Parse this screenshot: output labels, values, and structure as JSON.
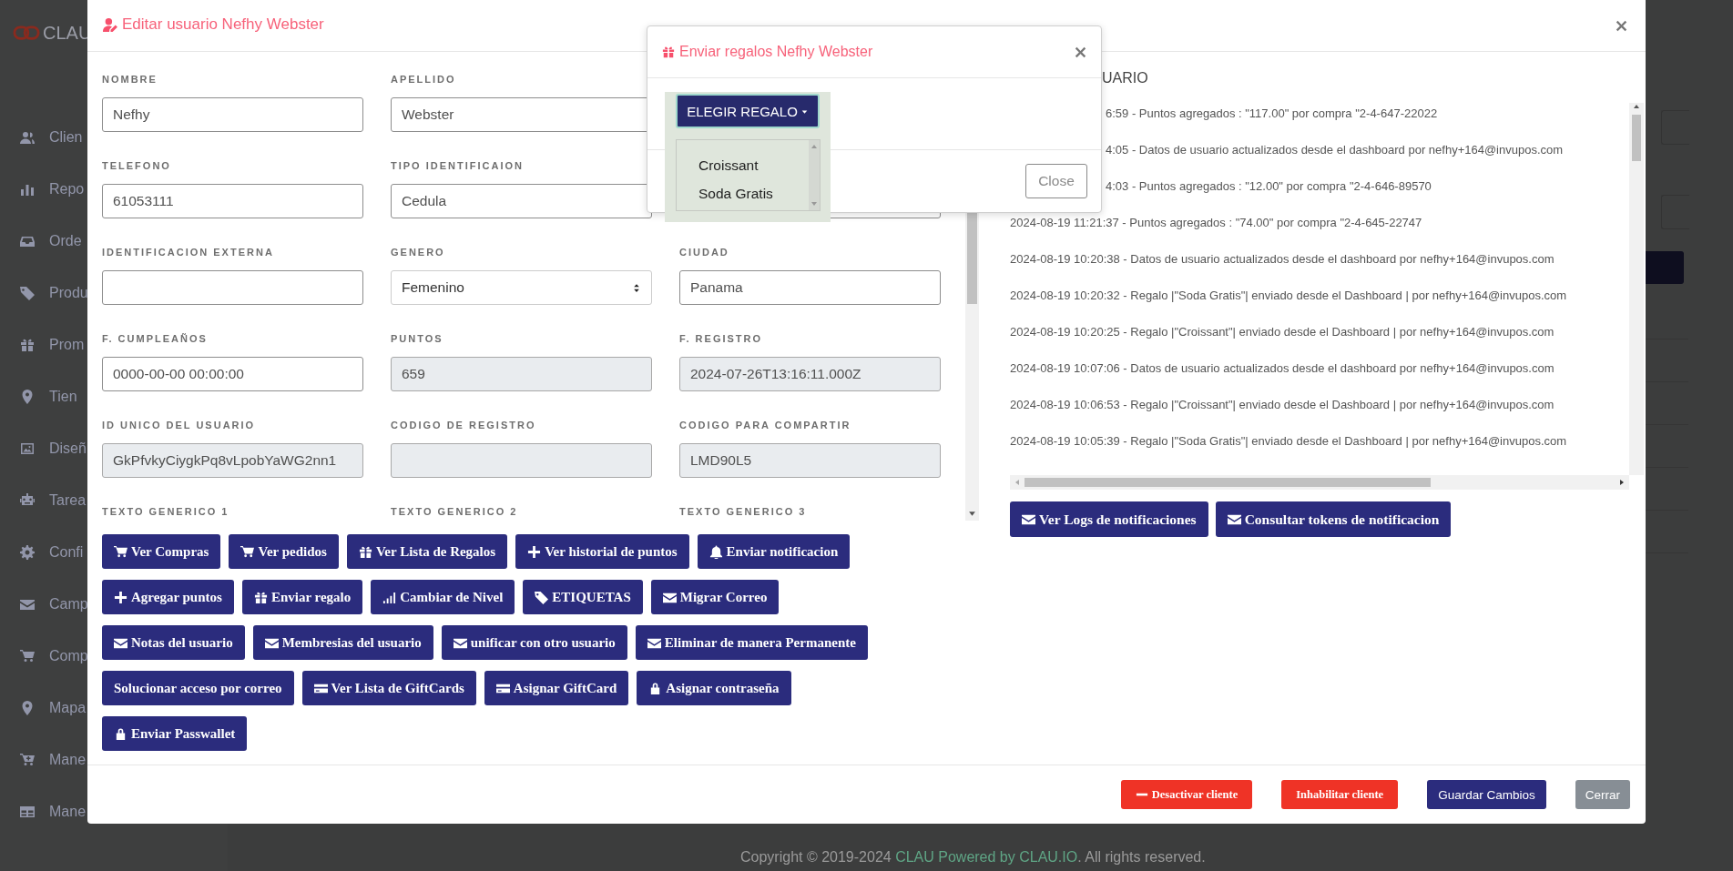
{
  "sidebar": {
    "logo": "CLAU",
    "items": [
      {
        "label": "Clien",
        "kind": "users"
      },
      {
        "label": "Repo",
        "kind": "bars"
      },
      {
        "label": "Orde",
        "kind": "inbox"
      },
      {
        "label": "Produ",
        "kind": "tag"
      },
      {
        "label": "Prom",
        "kind": "gift"
      },
      {
        "label": "Tien",
        "kind": "pin"
      },
      {
        "label": "Diseñ",
        "kind": "image"
      },
      {
        "label": "Tarea",
        "kind": "robot"
      },
      {
        "label": "Confi",
        "kind": "gear"
      },
      {
        "label": "Camp",
        "kind": "envelope"
      },
      {
        "label": "Comp",
        "kind": "cart"
      },
      {
        "label": "Mapa",
        "kind": "pin"
      },
      {
        "label": "Mane",
        "kind": "cartplus"
      },
      {
        "label": "Mane",
        "kind": "table"
      }
    ]
  },
  "footer": {
    "before": "Copyright © 2019-2024",
    "link": "CLAU Powered by CLAU.IO",
    "after": ". All rights reserved."
  },
  "modal": {
    "title": "Editar usuario Nefhy Webster",
    "fields": [
      [
        {
          "label": "NOMBRE",
          "value": "Nefhy",
          "kind": "input"
        },
        {
          "label": "APELLIDO",
          "value": "Webster",
          "kind": "input"
        }
      ],
      [
        {
          "label": "TELEFONO",
          "value": "61053111",
          "kind": "input"
        },
        {
          "label": "TIPO IDENTIFICAION",
          "value": "Cedula",
          "kind": "input"
        },
        {
          "kind": "input"
        }
      ],
      [
        {
          "label": "IDENTIFICACION EXTERNA",
          "kind": "input"
        },
        {
          "label": "GENERO",
          "value": "Femenino",
          "kind": "select"
        },
        {
          "label": "CIUDAD",
          "value": "Panama",
          "kind": "input"
        }
      ],
      [
        {
          "label": "F. CUMPLEAÑOS",
          "value": "0000-00-00 00:00:00",
          "kind": "input"
        },
        {
          "label": "PUNTOS",
          "value": "659",
          "kind": "disabled"
        },
        {
          "label": "F. REGISTRO",
          "value": "2024-07-26T13:16:11.000Z",
          "kind": "disabled"
        }
      ],
      [
        {
          "label": "ID UNICO DEL USUARIO",
          "value": "GkPfvkyCiygkPq8vLpobYaWG2nn1",
          "kind": "disabled"
        },
        {
          "label": "CODIGO DE REGISTRO",
          "kind": "disabled"
        },
        {
          "label": "CODIGO PARA COMPARTIR",
          "value": "LMD90L5",
          "kind": "disabled"
        }
      ],
      [
        {
          "label": "TEXTO GENERICO 1",
          "kind": "label"
        },
        {
          "label": "TEXTO GENERICO 2",
          "kind": "label"
        },
        {
          "label": "TEXTO GENERICO 3",
          "kind": "label"
        }
      ]
    ],
    "actions": [
      [
        {
          "label": "Ver Compras",
          "kind": "cart"
        },
        {
          "label": "Ver pedidos",
          "kind": "cart"
        },
        {
          "label": "Ver Lista de Regalos",
          "kind": "gift"
        },
        {
          "label": "Ver historial de puntos",
          "kind": "plus"
        },
        {
          "label": "Enviar notificacion",
          "kind": "bell"
        }
      ],
      [
        {
          "label": "Agregar puntos",
          "kind": "plus"
        },
        {
          "label": "Enviar regalo",
          "kind": "gift"
        },
        {
          "label": "Cambiar de Nivel",
          "kind": "signal"
        },
        {
          "label": "ETIQUETAS",
          "kind": "tag"
        },
        {
          "label": "Migrar Correo",
          "kind": "envelope"
        }
      ],
      [
        {
          "label": "Notas del usuario",
          "kind": "envelope"
        },
        {
          "label": "Membresias del usuario",
          "kind": "envelope"
        },
        {
          "label": "unificar con otro usuario",
          "kind": "envelope"
        },
        {
          "label": "Eliminar de manera Permanente",
          "kind": "envelope"
        }
      ],
      [
        {
          "label": "Solucionar acceso por correo",
          "kind": "none"
        },
        {
          "label": "Ver Lista de GiftCards",
          "kind": "card"
        },
        {
          "label": "Asignar GiftCard",
          "kind": "card"
        },
        {
          "label": "Asignar contraseña",
          "kind": "lock"
        }
      ],
      [
        {
          "label": "Enviar Passwallet",
          "kind": "lock"
        }
      ]
    ],
    "log_title": "UARIO",
    "log": [
      {
        "text": "6:59 - Puntos agregados : \"117.00\" por compra \"2-4-647-22022",
        "kind": "partial"
      },
      {
        "text": "4:05 - Datos de usuario actualizados desde el dashboard por nefhy+164@invupos.com",
        "kind": "partial"
      },
      {
        "text": "4:03 - Puntos agregados : \"12.00\" por compra \"2-4-646-89570",
        "kind": "partial"
      },
      {
        "text": "2024-08-19 11:21:37 - Puntos agregados : \"74.00\" por compra \"2-4-645-22747",
        "kind": "full"
      },
      {
        "text": "2024-08-19 10:20:38 - Datos de usuario actualizados desde el dashboard por nefhy+164@invupos.com",
        "kind": "full"
      },
      {
        "text": "2024-08-19 10:20:32 - Regalo |\"Soda Gratis\"| enviado desde el Dashboard | por nefhy+164@invupos.com",
        "kind": "full"
      },
      {
        "text": "2024-08-19 10:20:25 - Regalo |\"Croissant\"| enviado desde el Dashboard | por nefhy+164@invupos.com",
        "kind": "full"
      },
      {
        "text": "2024-08-19 10:07:06 - Datos de usuario actualizados desde el dashboard por nefhy+164@invupos.com",
        "kind": "full"
      },
      {
        "text": "2024-08-19 10:06:53 - Regalo |\"Croissant\"| enviado desde el Dashboard | por nefhy+164@invupos.com",
        "kind": "full"
      },
      {
        "text": "2024-08-19 10:05:39 - Regalo |\"Soda Gratis\"| enviado desde el Dashboard | por nefhy+164@invupos.com",
        "kind": "full"
      }
    ],
    "log_actions": [
      {
        "label": "Ver Logs de notificaciones",
        "kind": "envelope"
      },
      {
        "label": "Consultar tokens de notificacion",
        "kind": "envelope"
      }
    ],
    "footer_buttons": [
      {
        "label": "Desactivar cliente",
        "kind": "danger_minus"
      },
      {
        "label": "Inhabilitar cliente",
        "kind": "danger"
      },
      {
        "label": "Guardar Cambios",
        "kind": "primary"
      },
      {
        "label": "Cerrar",
        "kind": "secondary"
      }
    ]
  },
  "gift_dialog": {
    "title": "Enviar regalos Nefhy Webster",
    "dropdown": "ELEGIR REGALO",
    "options": [
      "Croissant",
      "Soda Gratis"
    ],
    "close": "Close"
  }
}
